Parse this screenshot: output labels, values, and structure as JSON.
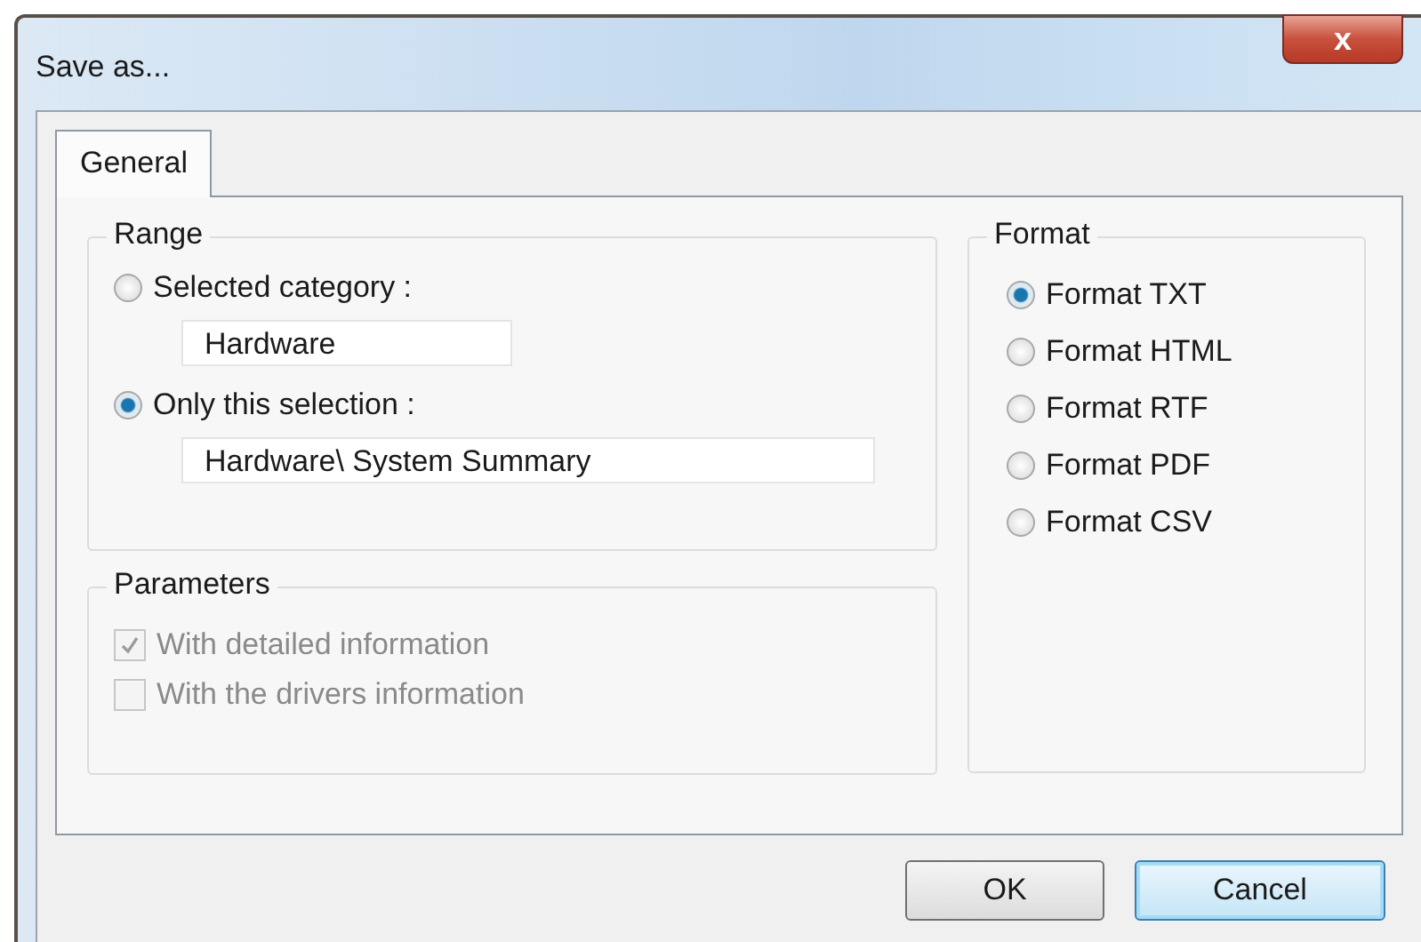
{
  "window": {
    "title": "Save as...",
    "close": "x"
  },
  "tabs": [
    {
      "label": "General",
      "selected": true
    }
  ],
  "range": {
    "title": "Range",
    "options": [
      {
        "label": "Selected category :",
        "selected": false,
        "value": "Hardware",
        "wide": false
      },
      {
        "label": "Only this selection :",
        "selected": true,
        "value": "Hardware\\ System Summary",
        "wide": true
      }
    ]
  },
  "parameters": {
    "title": "Parameters",
    "items": [
      {
        "label": "With detailed information",
        "checked": true,
        "disabled": true
      },
      {
        "label": "With the drivers information",
        "checked": false,
        "disabled": true
      }
    ]
  },
  "format": {
    "title": "Format",
    "options": [
      {
        "label": "Format TXT",
        "selected": true
      },
      {
        "label": "Format HTML",
        "selected": false
      },
      {
        "label": "Format RTF",
        "selected": false
      },
      {
        "label": "Format PDF",
        "selected": false
      },
      {
        "label": "Format CSV",
        "selected": false
      }
    ]
  },
  "buttons": [
    {
      "label": "OK",
      "default": false
    },
    {
      "label": "Cancel",
      "default": true
    }
  ]
}
